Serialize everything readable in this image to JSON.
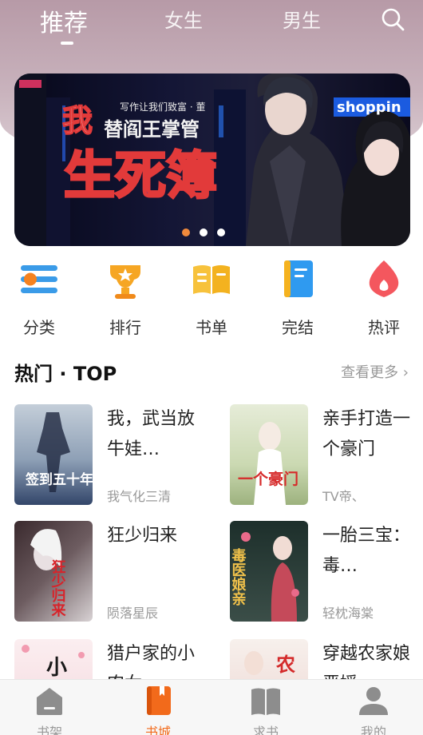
{
  "header": {
    "tabs": [
      {
        "label": "推荐"
      },
      {
        "label": "女生"
      },
      {
        "label": "男生"
      }
    ],
    "active_tab": 0,
    "search_icon": "search-icon"
  },
  "banner": {
    "headline_line1": "我",
    "headline_line2": "替阎王掌管",
    "headline_big": "生死簿",
    "slogan": "写作让我们致富 · 董",
    "sign_text": "shoppin",
    "dots": 3,
    "active_dot": 0
  },
  "quick_nav": [
    {
      "label": "分类",
      "icon": "category-icon"
    },
    {
      "label": "排行",
      "icon": "trophy-icon"
    },
    {
      "label": "书单",
      "icon": "booklist-icon"
    },
    {
      "label": "完结",
      "icon": "finished-book-icon"
    },
    {
      "label": "热评",
      "icon": "hot-comment-icon"
    }
  ],
  "section": {
    "title": "热门 · TOP",
    "more": "查看更多 ›"
  },
  "books": [
    {
      "title": "我，武当放牛娃…",
      "author": "我气化三清",
      "cover_text": "签到五十年",
      "cover_colors": [
        "#9fb0c4",
        "#2a3d5c"
      ]
    },
    {
      "title": "亲手打造一个豪门",
      "author": "TV帝、",
      "cover_text": "一个豪门",
      "cover_colors": [
        "#d8e0c8",
        "#a9bd8f"
      ]
    },
    {
      "title": "狂少归来",
      "author": "陨落星辰",
      "cover_text": "狂少归来",
      "cover_colors": [
        "#3a2a2e",
        "#c9c0c2"
      ]
    },
    {
      "title": "一胎三宝：毒…",
      "author": "轻枕海棠",
      "cover_text": "毒医娘亲",
      "cover_colors": [
        "#1d2f2b",
        "#3b4e48"
      ]
    },
    {
      "title": "猎户家的小农女",
      "author": "",
      "cover_text": "小",
      "cover_colors": [
        "#f3e3e6",
        "#f7cfd6"
      ]
    },
    {
      "title": "穿越农家娘恶媛",
      "author": "",
      "cover_text": "农",
      "cover_colors": [
        "#f4ece8",
        "#e7c7c3"
      ]
    }
  ],
  "bottom_nav": [
    {
      "label": "书架",
      "icon": "bookshelf-icon"
    },
    {
      "label": "书城",
      "icon": "bookstore-icon"
    },
    {
      "label": "求书",
      "icon": "request-book-icon"
    },
    {
      "label": "我的",
      "icon": "profile-icon"
    }
  ],
  "active_nav": 1,
  "colors": {
    "accent": "#f26a1b",
    "banner_red": "#e23a3a",
    "muted": "#999999"
  }
}
